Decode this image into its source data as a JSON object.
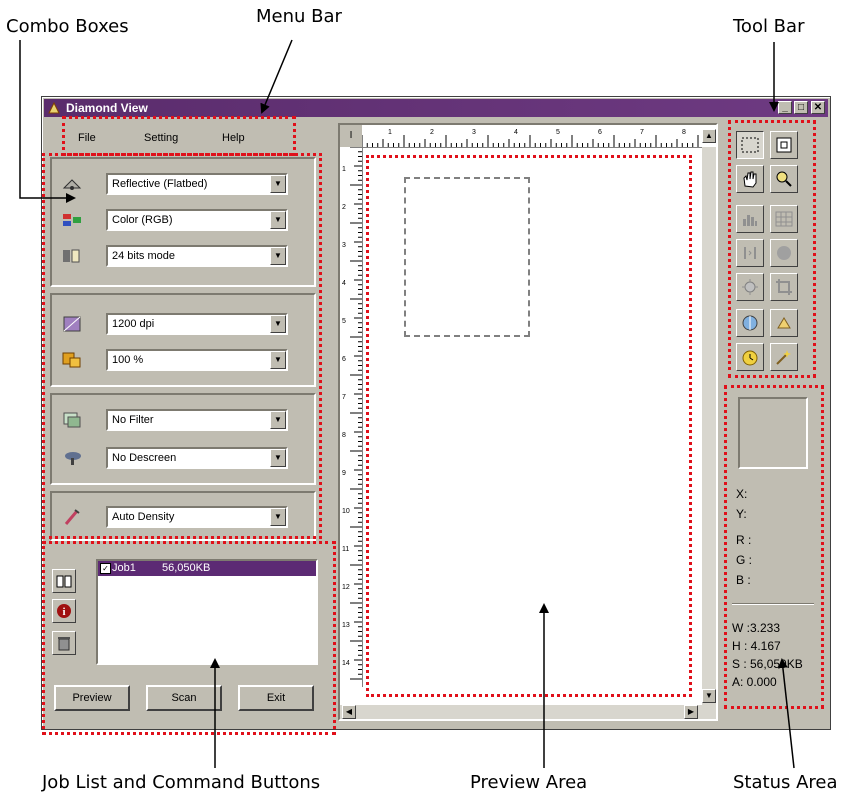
{
  "callouts": {
    "combo_boxes": "Combo Boxes",
    "menu_bar": "Menu Bar",
    "tool_bar": "Tool Bar",
    "job_list": "Job List and Command Buttons",
    "preview_area": "Preview Area",
    "status_area": "Status Area"
  },
  "window": {
    "title": "Diamond View",
    "minimize": "_",
    "maximize": "□",
    "close": "✕"
  },
  "menu": [
    "File",
    "Setting",
    "Help"
  ],
  "combos": {
    "scan_source": "Reflective (Flatbed)",
    "color_mode": "Color (RGB)",
    "bit_mode": "24 bits mode",
    "resolution": "1200 dpi",
    "scale": "100 %",
    "filter": "No Filter",
    "descreen": "No Descreen",
    "density": "Auto Density"
  },
  "ruler": {
    "corner": "I",
    "h_ticks": [
      "1",
      "2",
      "3",
      "4",
      "5",
      "6",
      "7",
      "8"
    ],
    "v_ticks": [
      "1",
      "2",
      "3",
      "4",
      "5",
      "6",
      "7",
      "8",
      "9",
      "10",
      "11",
      "12",
      "13",
      "14"
    ]
  },
  "job": {
    "name": "Job1",
    "size": "56,050KB"
  },
  "buttons": {
    "preview": "Preview",
    "scan": "Scan",
    "exit": "Exit"
  },
  "status": {
    "x": "X:",
    "y": "Y:",
    "r": "R :",
    "g": "G :",
    "b": "B :",
    "w": "W :3.233",
    "h": "H : 4.167",
    "s": "S : 56,050KB",
    "a": "A: 0.000"
  },
  "colors": {
    "title_bar": "#5a2c6c",
    "job_highlight": "#5c2a74",
    "annotation": "#e0101a",
    "window_face": "#c0bdb2"
  }
}
